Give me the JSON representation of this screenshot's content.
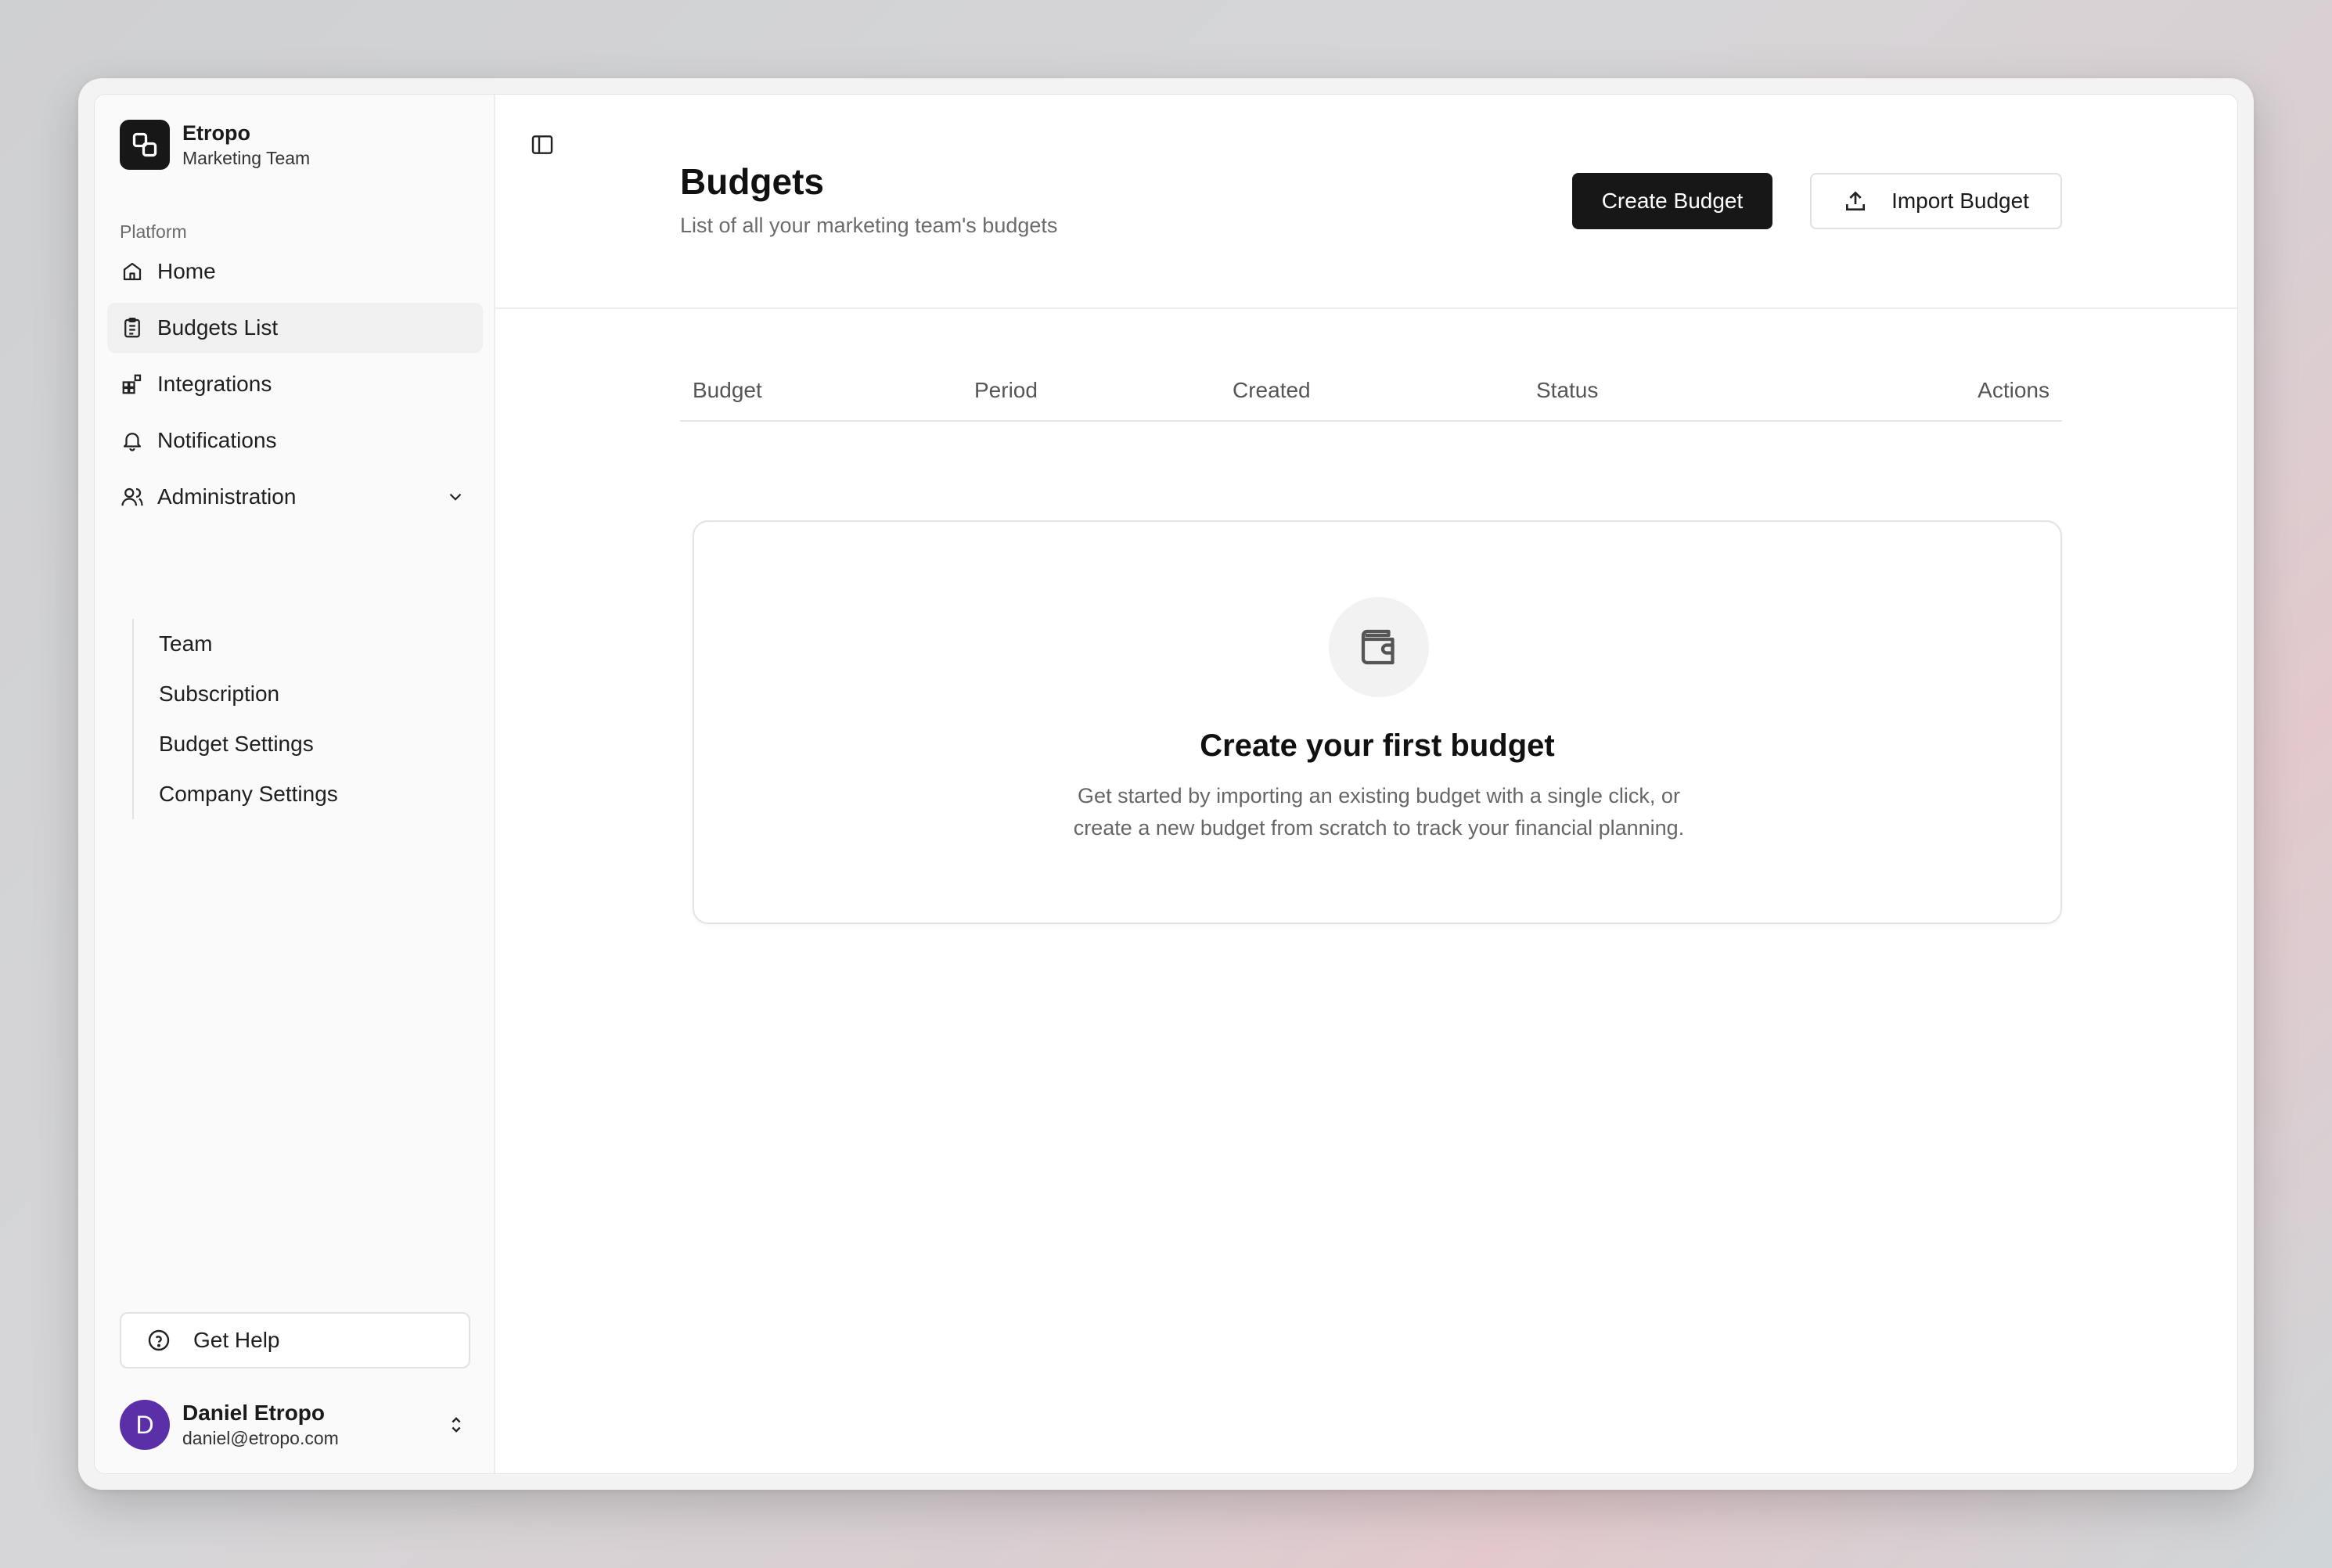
{
  "org": {
    "name": "Etropo",
    "team": "Marketing Team"
  },
  "sidebar": {
    "section_label": "Platform",
    "items": [
      {
        "label": "Home",
        "icon": "home-icon"
      },
      {
        "label": "Budgets List",
        "icon": "clipboard-icon"
      },
      {
        "label": "Integrations",
        "icon": "grid-icon"
      },
      {
        "label": "Notifications",
        "icon": "bell-icon"
      },
      {
        "label": "Administration",
        "icon": "users-icon"
      }
    ],
    "sub_items": [
      "Team",
      "Subscription",
      "Budget Settings",
      "Company Settings"
    ],
    "help_label": "Get Help"
  },
  "user": {
    "initial": "D",
    "name": "Daniel Etropo",
    "email": "daniel@etropo.com"
  },
  "header": {
    "title": "Budgets",
    "subtitle": "List of all your marketing team's budgets",
    "create_label": "Create Budget",
    "import_label": "Import Budget"
  },
  "table": {
    "columns": [
      "Budget",
      "Period",
      "Created",
      "Status",
      "Actions"
    ]
  },
  "empty_state": {
    "title": "Create your first budget",
    "line1": "Get started by importing an existing budget with a single click, or",
    "line2": "create a new budget from scratch to track your financial planning."
  },
  "colors": {
    "primary": "#171717",
    "avatar": "#5b2fa8",
    "muted_text": "#6b6b6b"
  }
}
